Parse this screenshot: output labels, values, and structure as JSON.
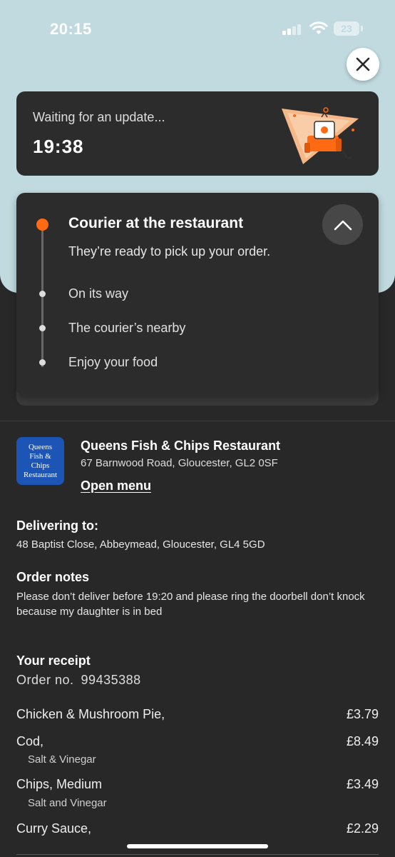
{
  "status_bar": {
    "time": "20:15",
    "battery": "23"
  },
  "tracking": {
    "update_label": "Waiting for an update...",
    "update_time": "19:38",
    "current_step_title": "Courier at the restaurant",
    "current_step_subtitle": "They’re ready to pick up your order.",
    "steps": [
      "On its way",
      "The courier’s nearby",
      "Enjoy your food"
    ]
  },
  "restaurant": {
    "logo_text": "Queens Fish & Chips Restaurant",
    "logo_lines": [
      "Queens",
      "Fish &",
      "Chips",
      "Restaurant"
    ],
    "name": "Queens Fish & Chips Restaurant",
    "address": "67 Barnwood Road, Gloucester, GL2 0SF",
    "open_menu_label": "Open menu"
  },
  "delivery": {
    "title": "Delivering to:",
    "address": "48 Baptist Close, Abbeymead, Gloucester, GL4 5GD"
  },
  "notes": {
    "title": "Order notes",
    "text": "Please don’t deliver before 19:20 and please ring the doorbell don’t knock because my daughter is in bed"
  },
  "receipt": {
    "title": "Your receipt",
    "order_label": "Order no.",
    "order_number": "99435388",
    "items": [
      {
        "name": "Chicken & Mushroom Pie,",
        "price": "£3.79",
        "modifier": ""
      },
      {
        "name": "Cod,",
        "price": "£8.49",
        "modifier": "Salt & Vinegar"
      },
      {
        "name": "Chips, Medium",
        "price": "£3.49",
        "modifier": "Salt and Vinegar"
      },
      {
        "name": "Curry Sauce,",
        "price": "£2.29",
        "modifier": ""
      }
    ]
  },
  "colors": {
    "accent": "#ff6a13",
    "header_background": "#c0dadf",
    "page_background": "#282828",
    "card_background": "#2c2c2c",
    "logo_background": "#1c55b5"
  },
  "icons": [
    "close-icon",
    "chevron-up-icon",
    "signal-icon",
    "wifi-icon",
    "battery-icon"
  ]
}
